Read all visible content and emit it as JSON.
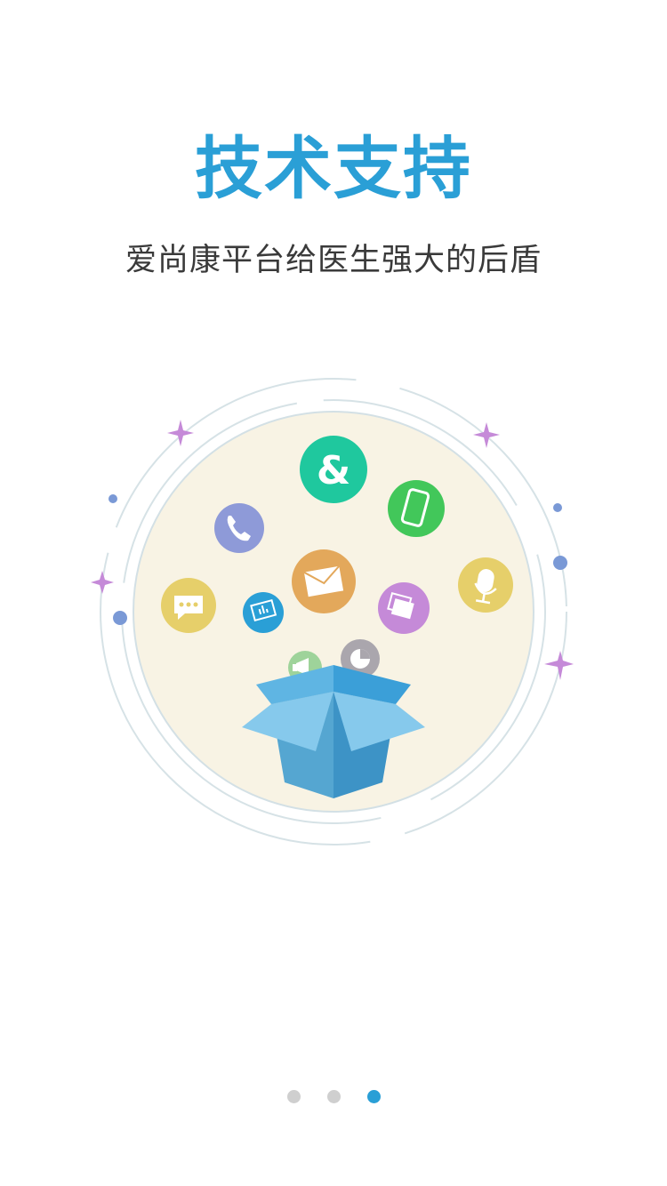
{
  "intro": {
    "title": "技术支持",
    "subtitle": "爱尚康平台给医生强大的后盾"
  },
  "colors": {
    "accent": "#2a9fd6",
    "dot_inactive": "#cfcfcf",
    "circle_fill": "#f8f3e4"
  },
  "illustration": {
    "icons": [
      {
        "name": "ampersand-app-icon",
        "color": "#1fc89e",
        "glyph": "&"
      },
      {
        "name": "phone-icon",
        "color": "#8e9ad8"
      },
      {
        "name": "mobile-device-icon",
        "color": "#42c75a"
      },
      {
        "name": "mail-icon",
        "color": "#e3a85b"
      },
      {
        "name": "chat-bubble-icon",
        "color": "#e6cf6a"
      },
      {
        "name": "presentation-icon",
        "color": "#2a9fd6"
      },
      {
        "name": "photo-gallery-icon",
        "color": "#c58ad8"
      },
      {
        "name": "microphone-icon",
        "color": "#e6cf6a"
      },
      {
        "name": "megaphone-icon",
        "color": "#9ed39a"
      },
      {
        "name": "pie-chart-icon",
        "color": "#aaa6ad"
      },
      {
        "name": "open-box-icon",
        "color": "#4aa3d4"
      }
    ]
  },
  "pager": {
    "total": 3,
    "active_index": 2
  }
}
